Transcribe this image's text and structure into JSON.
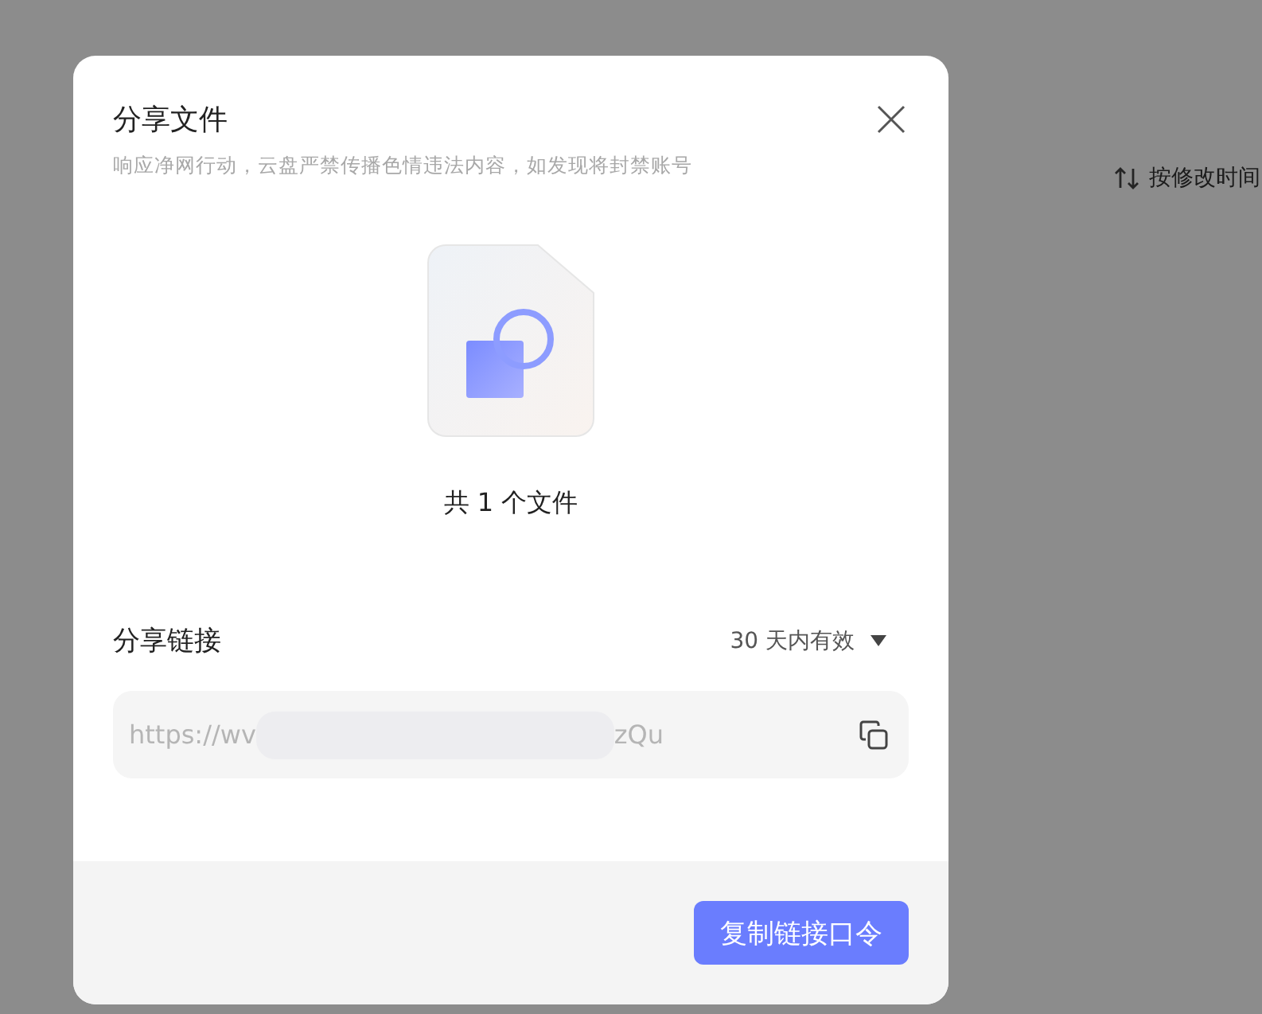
{
  "background": {
    "sort_label": "按修改时间"
  },
  "dialog": {
    "title": "分享文件",
    "notice": "响应净网行动，云盘严禁传播色情违法内容，如发现将封禁账号",
    "file_count": "共 1 个文件",
    "link_label": "分享链接",
    "validity": "30 天内有效",
    "link": {
      "prefix": "https://wv",
      "suffix": "zQu"
    },
    "button": "复制链接口令"
  }
}
